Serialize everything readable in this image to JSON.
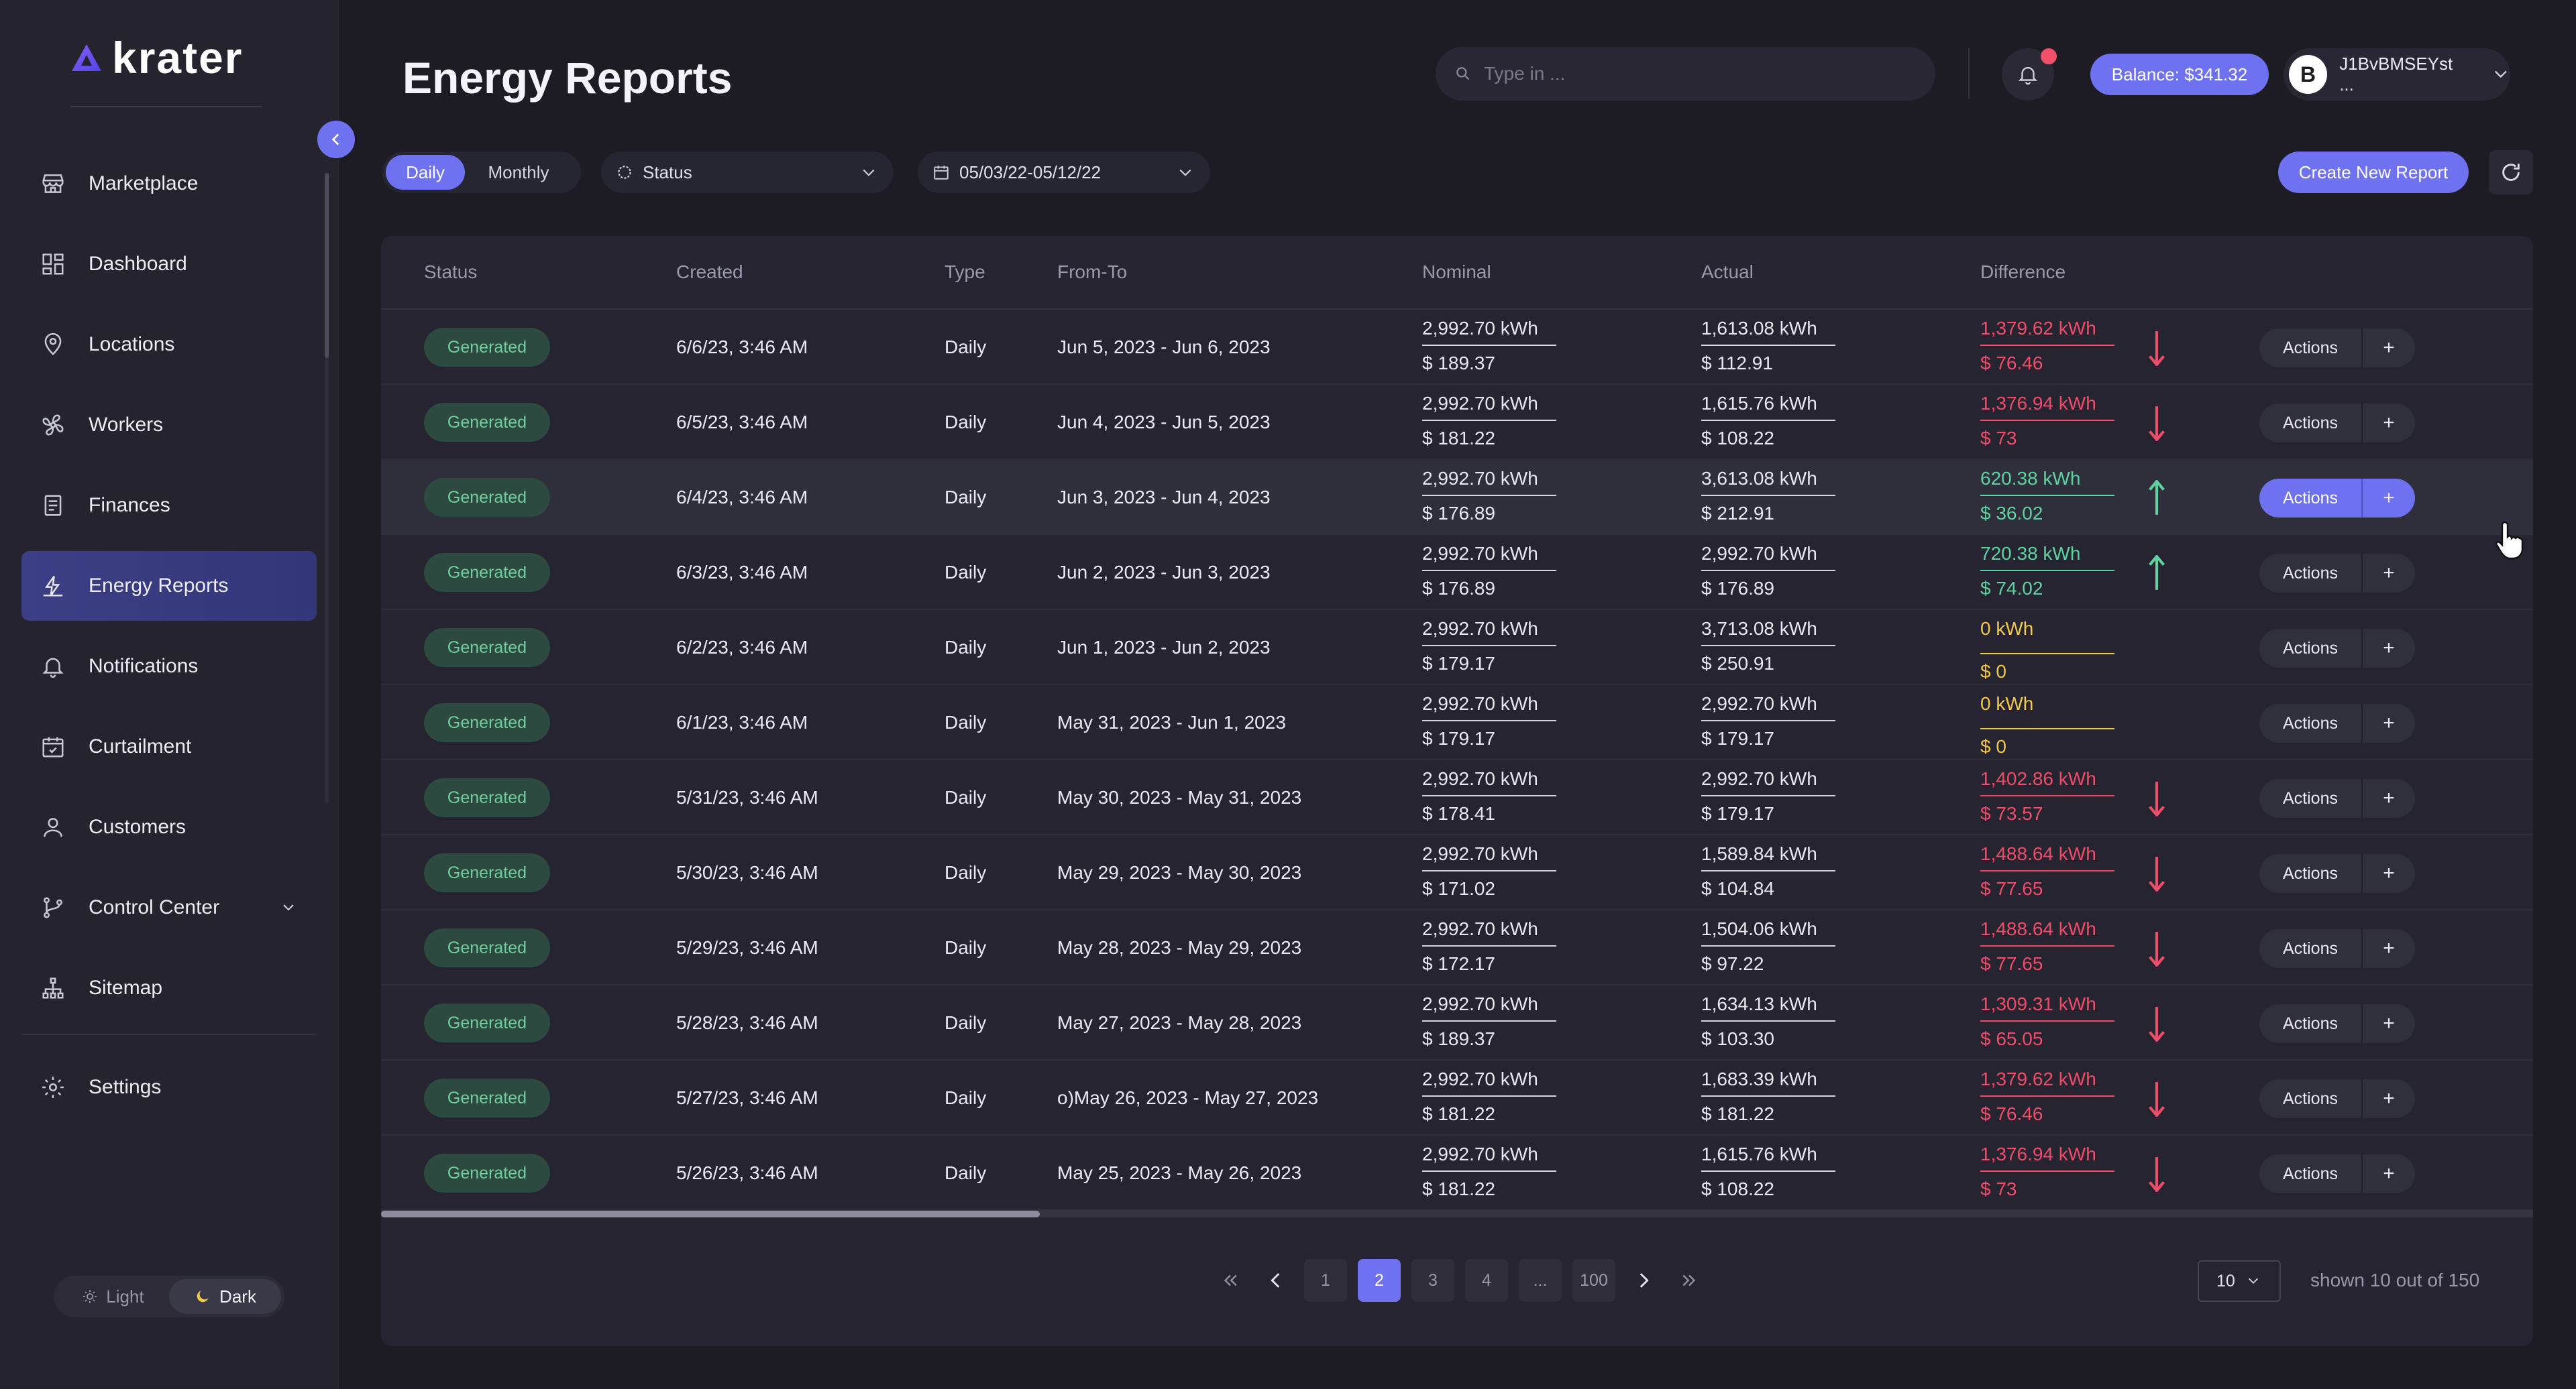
{
  "app": {
    "name": "krater"
  },
  "page": {
    "title": "Energy Reports"
  },
  "sidebar": {
    "items": [
      {
        "label": "Marketplace",
        "icon": "store-icon"
      },
      {
        "label": "Dashboard",
        "icon": "grid-icon"
      },
      {
        "label": "Locations",
        "icon": "location-pin-icon"
      },
      {
        "label": "Workers",
        "icon": "fan-icon"
      },
      {
        "label": "Finances",
        "icon": "receipt-icon"
      },
      {
        "label": "Energy Reports",
        "icon": "flash-chart-icon"
      },
      {
        "label": "Notifications",
        "icon": "bell-icon"
      },
      {
        "label": "Curtailment",
        "icon": "calendar-check-icon"
      },
      {
        "label": "Customers",
        "icon": "user-icon"
      },
      {
        "label": "Control Center",
        "icon": "git-branch-icon"
      },
      {
        "label": "Sitemap",
        "icon": "sitemap-icon"
      }
    ],
    "settings_label": "Settings",
    "active": "Energy Reports",
    "theme": {
      "light_label": "Light",
      "dark_label": "Dark",
      "selected": "Dark"
    }
  },
  "header": {
    "search_placeholder": "Type in ...",
    "balance_label": "Balance: $341.32",
    "account_name": "J1BvBMSEYst ...",
    "coin_symbol": "B",
    "has_notification": true
  },
  "filters": {
    "period_options": [
      "Daily",
      "Monthly"
    ],
    "period_selected": "Daily",
    "status_label": "Status",
    "date_range": "05/03/22-05/12/22",
    "create_label": "Create New Report"
  },
  "table": {
    "columns": [
      "Status",
      "Created",
      "Type",
      "From-To",
      "Nominal",
      "Actual",
      "Difference"
    ],
    "rows": [
      {
        "status": "Generated",
        "created": "6/6/23, 3:46 AM",
        "type": "Daily",
        "from_to": "Jun 5, 2023 - Jun 6, 2023",
        "nominal_kwh": "2,992.70 kWh",
        "nominal_usd": "$ 189.37",
        "actual_kwh": "1,613.08 kWh",
        "actual_usd": "$ 112.91",
        "diff_kwh": "1,379.62 kWh",
        "diff_usd": "$ 76.46",
        "trend": "down"
      },
      {
        "status": "Generated",
        "created": "6/5/23, 3:46 AM",
        "type": "Daily",
        "from_to": "Jun 4, 2023 - Jun 5, 2023",
        "nominal_kwh": "2,992.70 kWh",
        "nominal_usd": "$ 181.22",
        "actual_kwh": "1,615.76 kWh",
        "actual_usd": "$ 108.22",
        "diff_kwh": "1,376.94 kWh",
        "diff_usd": "$ 73",
        "trend": "down"
      },
      {
        "status": "Generated",
        "created": "6/4/23, 3:46 AM",
        "type": "Daily",
        "from_to": "Jun 3, 2023 - Jun 4, 2023",
        "nominal_kwh": "2,992.70 kWh",
        "nominal_usd": "$ 176.89",
        "actual_kwh": "3,613.08 kWh",
        "actual_usd": "$ 212.91",
        "diff_kwh": "620.38 kWh",
        "diff_usd": "$ 36.02",
        "trend": "up"
      },
      {
        "status": "Generated",
        "created": "6/3/23, 3:46 AM",
        "type": "Daily",
        "from_to": "Jun 2, 2023 - Jun 3, 2023",
        "nominal_kwh": "2,992.70 kWh",
        "nominal_usd": "$ 176.89",
        "actual_kwh": "2,992.70 kWh",
        "actual_usd": "$ 176.89",
        "diff_kwh": "720.38 kWh",
        "diff_usd": "$ 74.02",
        "trend": "up"
      },
      {
        "status": "Generated",
        "created": "6/2/23, 3:46 AM",
        "type": "Daily",
        "from_to": "Jun 1, 2023 - Jun 2, 2023",
        "nominal_kwh": "2,992.70 kWh",
        "nominal_usd": "$ 179.17",
        "actual_kwh": "3,713.08 kWh",
        "actual_usd": "$ 250.91",
        "diff_kwh": "0 kWh",
        "diff_usd": "$ 0",
        "trend": "none"
      },
      {
        "status": "Generated",
        "created": "6/1/23, 3:46 AM",
        "type": "Daily",
        "from_to": "May 31, 2023 - Jun 1, 2023",
        "nominal_kwh": "2,992.70 kWh",
        "nominal_usd": "$ 179.17",
        "actual_kwh": "2,992.70 kWh",
        "actual_usd": "$ 179.17",
        "diff_kwh": "0 kWh",
        "diff_usd": "$ 0",
        "trend": "none"
      },
      {
        "status": "Generated",
        "created": "5/31/23, 3:46 AM",
        "type": "Daily",
        "from_to": "May 30, 2023 - May 31, 2023",
        "nominal_kwh": "2,992.70 kWh",
        "nominal_usd": "$ 178.41",
        "actual_kwh": "2,992.70 kWh",
        "actual_usd": "$ 179.17",
        "diff_kwh": "1,402.86 kWh",
        "diff_usd": "$ 73.57",
        "trend": "down"
      },
      {
        "status": "Generated",
        "created": "5/30/23, 3:46 AM",
        "type": "Daily",
        "from_to": "May 29, 2023 - May 30, 2023",
        "nominal_kwh": "2,992.70 kWh",
        "nominal_usd": "$ 171.02",
        "actual_kwh": "1,589.84 kWh",
        "actual_usd": "$ 104.84",
        "diff_kwh": "1,488.64 kWh",
        "diff_usd": "$ 77.65",
        "trend": "down"
      },
      {
        "status": "Generated",
        "created": "5/29/23, 3:46 AM",
        "type": "Daily",
        "from_to": "May 28, 2023 - May 29, 2023",
        "nominal_kwh": "2,992.70 kWh",
        "nominal_usd": "$ 172.17",
        "actual_kwh": "1,504.06 kWh",
        "actual_usd": "$ 97.22",
        "diff_kwh": "1,488.64 kWh",
        "diff_usd": "$ 77.65",
        "trend": "down"
      },
      {
        "status": "Generated",
        "created": "5/28/23, 3:46 AM",
        "type": "Daily",
        "from_to": "May 27, 2023 - May 28, 2023",
        "nominal_kwh": "2,992.70 kWh",
        "nominal_usd": "$ 189.37",
        "actual_kwh": "1,634.13 kWh",
        "actual_usd": "$ 103.30",
        "diff_kwh": "1,309.31 kWh",
        "diff_usd": "$ 65.05",
        "trend": "down"
      },
      {
        "status": "Generated",
        "created": "5/27/23, 3:46 AM",
        "type": "Daily",
        "from_to": "o)May 26, 2023 - May 27, 2023",
        "nominal_kwh": "2,992.70 kWh",
        "nominal_usd": "$ 181.22",
        "actual_kwh": "1,683.39 kWh",
        "actual_usd": "$ 181.22",
        "diff_kwh": "1,379.62 kWh",
        "diff_usd": "$ 76.46",
        "trend": "down"
      },
      {
        "status": "Generated",
        "created": "5/26/23, 3:46 AM",
        "type": "Daily",
        "from_to": "May 25, 2023 - May 26, 2023",
        "nominal_kwh": "2,992.70 kWh",
        "nominal_usd": "$ 181.22",
        "actual_kwh": "1,615.76 kWh",
        "actual_usd": "$ 108.22",
        "diff_kwh": "1,376.94 kWh",
        "diff_usd": "$ 73",
        "trend": "down"
      }
    ],
    "actions_label": "Actions",
    "actions_plus": "+",
    "highlighted_row_index": 2
  },
  "pagination": {
    "pages": [
      "1",
      "2",
      "3",
      "4",
      "...",
      "100"
    ],
    "current": "2",
    "page_size": "10",
    "shown_text": "shown 10 out of 150"
  },
  "colors": {
    "accent": "#6e72f0",
    "negative": "#ee4d6a",
    "positive": "#5fd2a0",
    "neutral": "#f1c94a",
    "badge_text": "#6fcf9a"
  }
}
